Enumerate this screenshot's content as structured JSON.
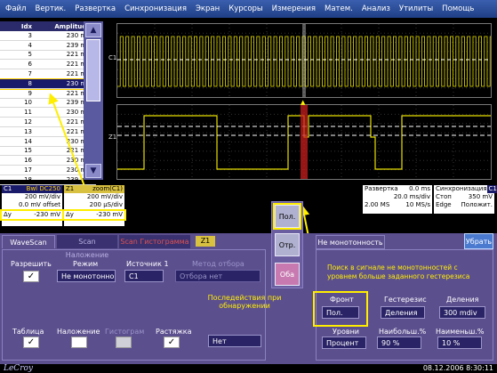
{
  "menu": [
    "Файл",
    "Вертик.",
    "Развертка",
    "Синхронизация",
    "Экран",
    "Курсоры",
    "Измерения",
    "Матем.",
    "Анализ",
    "Утилиты",
    "Помощь"
  ],
  "table": {
    "headers": [
      "Idx",
      "Amplitude"
    ],
    "rows": [
      [
        "3",
        "230 mV"
      ],
      [
        "4",
        "239 mV"
      ],
      [
        "5",
        "221 mV"
      ],
      [
        "6",
        "221 mV"
      ],
      [
        "7",
        "221 mV"
      ],
      [
        "8",
        "230 mV"
      ],
      [
        "9",
        "221 mV"
      ],
      [
        "10",
        "239 mV"
      ],
      [
        "11",
        "230 mV"
      ],
      [
        "12",
        "221 mV"
      ],
      [
        "13",
        "221 mV"
      ],
      [
        "14",
        "230 mV"
      ],
      [
        "15",
        "221 mV"
      ],
      [
        "16",
        "230 mV"
      ],
      [
        "17",
        "230 mV"
      ],
      [
        "18",
        "239 mV"
      ]
    ],
    "selected_index": 5
  },
  "graph1": {
    "label": "C1"
  },
  "graph2": {
    "label": "Z1"
  },
  "c1": {
    "name": "C1",
    "tags": "Bwl DC250",
    "line1": "200 mV/div",
    "line2": "0.0 mV offset",
    "dy_label": "Δy",
    "dy_value": "-230 mV"
  },
  "z1": {
    "name": "Z1",
    "title": "zoom(C1)",
    "line1": "200 mV/div",
    "line2": "200 µS/div",
    "dy_label": "Δy",
    "dy_value": "-230 mV"
  },
  "razv": {
    "title": "Развертка",
    "title_val": "0.0 ms",
    "l1a": "",
    "l1b": "20.0 ms/div",
    "l2a": "2.00 MS",
    "l2b": "10 MS/s"
  },
  "sync": {
    "title": "Синхронизация",
    "badge": "C1",
    "l1a": "Стоп",
    "l1b": "350 mV",
    "l2a": "Edge",
    "l2b": "Положит."
  },
  "side_buttons": [
    "Пол.",
    "Отр.",
    "Оба"
  ],
  "tabs": {
    "wavescan": "WaveScan",
    "overlay": "Scan Наложение",
    "histogram": "Scan Гистограмма",
    "z1": "Z1",
    "nonmono": "Не монотонность",
    "remove": "Убрать"
  },
  "controls": {
    "enable_label": "Разрешить",
    "mode_label": "Режим",
    "mode_value": "Не монотонно",
    "source_label": "Источник 1",
    "source_value": "C1",
    "method_label": "Метод отбора",
    "method_value": "Отбора нет",
    "table_label": "Таблица",
    "overlay_label": "Наложение",
    "histogram_label": "Гистограм",
    "stretch_label": "Растяжка",
    "actions_label": "Последействия при обнаружении",
    "actions_value": "Нет",
    "desc": "Поиск в сигнале не монотонностей с уровнем больше заданного гестерезиса",
    "front_label": "Фронт",
    "front_value": "Пол.",
    "hyst_label": "Гестерезис",
    "hyst_value": "Деления",
    "div_label": "Деления",
    "div_value": "300 mdiv",
    "levels_label": "Уровни",
    "levels_value": "Процент",
    "max_label": "Наибольш.%",
    "max_value": "90 %",
    "min_label": "Наименьш.%",
    "min_value": "10 %"
  },
  "status": {
    "logo": "LeCroy",
    "datetime": "08.12.2006 8:30:11"
  },
  "colors": {
    "trace": "#e8e000",
    "marker": "#c02020",
    "highlight": "#ffee00",
    "panel": "#5c4f8e"
  }
}
